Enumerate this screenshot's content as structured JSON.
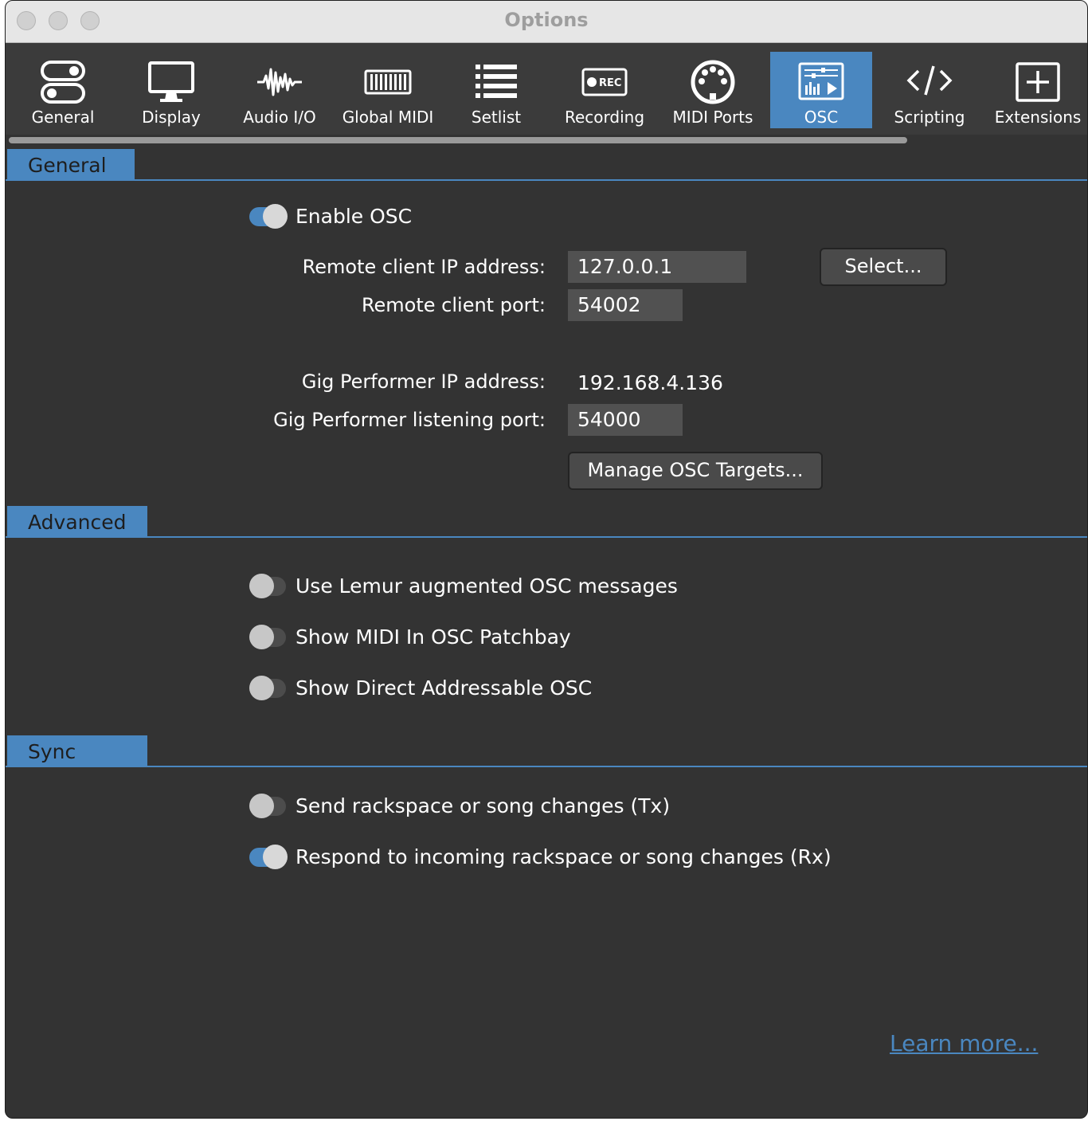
{
  "window": {
    "title": "Options"
  },
  "colors": {
    "accent": "#4a87c0",
    "background": "#333333",
    "toolbar": "#3b3b3b",
    "field": "#515151"
  },
  "tabs": [
    {
      "label": "General",
      "icon": "toggles-icon"
    },
    {
      "label": "Display",
      "icon": "monitor-icon"
    },
    {
      "label": "Audio I/O",
      "icon": "waveform-icon"
    },
    {
      "label": "Global MIDI",
      "icon": "keyboard-icon"
    },
    {
      "label": "Setlist",
      "icon": "list-icon"
    },
    {
      "label": "Recording",
      "icon": "rec-icon"
    },
    {
      "label": "MIDI Ports",
      "icon": "midi-din-icon"
    },
    {
      "label": "OSC",
      "icon": "osc-icon",
      "selected": true
    },
    {
      "label": "Scripting",
      "icon": "code-icon"
    },
    {
      "label": "Extensions",
      "icon": "plus-box-icon"
    }
  ],
  "general": {
    "title": "General",
    "enable_osc": {
      "label": "Enable OSC",
      "on": true
    },
    "remote_ip": {
      "label": "Remote client IP address:",
      "value": "127.0.0.1"
    },
    "select_button": "Select...",
    "remote_port": {
      "label": "Remote client port:",
      "value": "54002"
    },
    "gp_ip": {
      "label": "Gig Performer IP address:",
      "value": "192.168.4.136"
    },
    "gp_port": {
      "label": "Gig Performer listening port:",
      "value": "54000"
    },
    "manage_button": "Manage OSC Targets..."
  },
  "advanced": {
    "title": "Advanced",
    "lemur": {
      "label": "Use Lemur augmented OSC messages",
      "on": false
    },
    "midi_in": {
      "label": "Show MIDI In OSC Patchbay",
      "on": false
    },
    "direct": {
      "label": "Show Direct Addressable OSC",
      "on": false
    }
  },
  "sync": {
    "title": "Sync",
    "send": {
      "label": "Send rackspace or song changes (Tx)",
      "on": false
    },
    "respond": {
      "label": "Respond to incoming rackspace or song changes (Rx)",
      "on": true
    }
  },
  "learn_more": "Learn more..."
}
